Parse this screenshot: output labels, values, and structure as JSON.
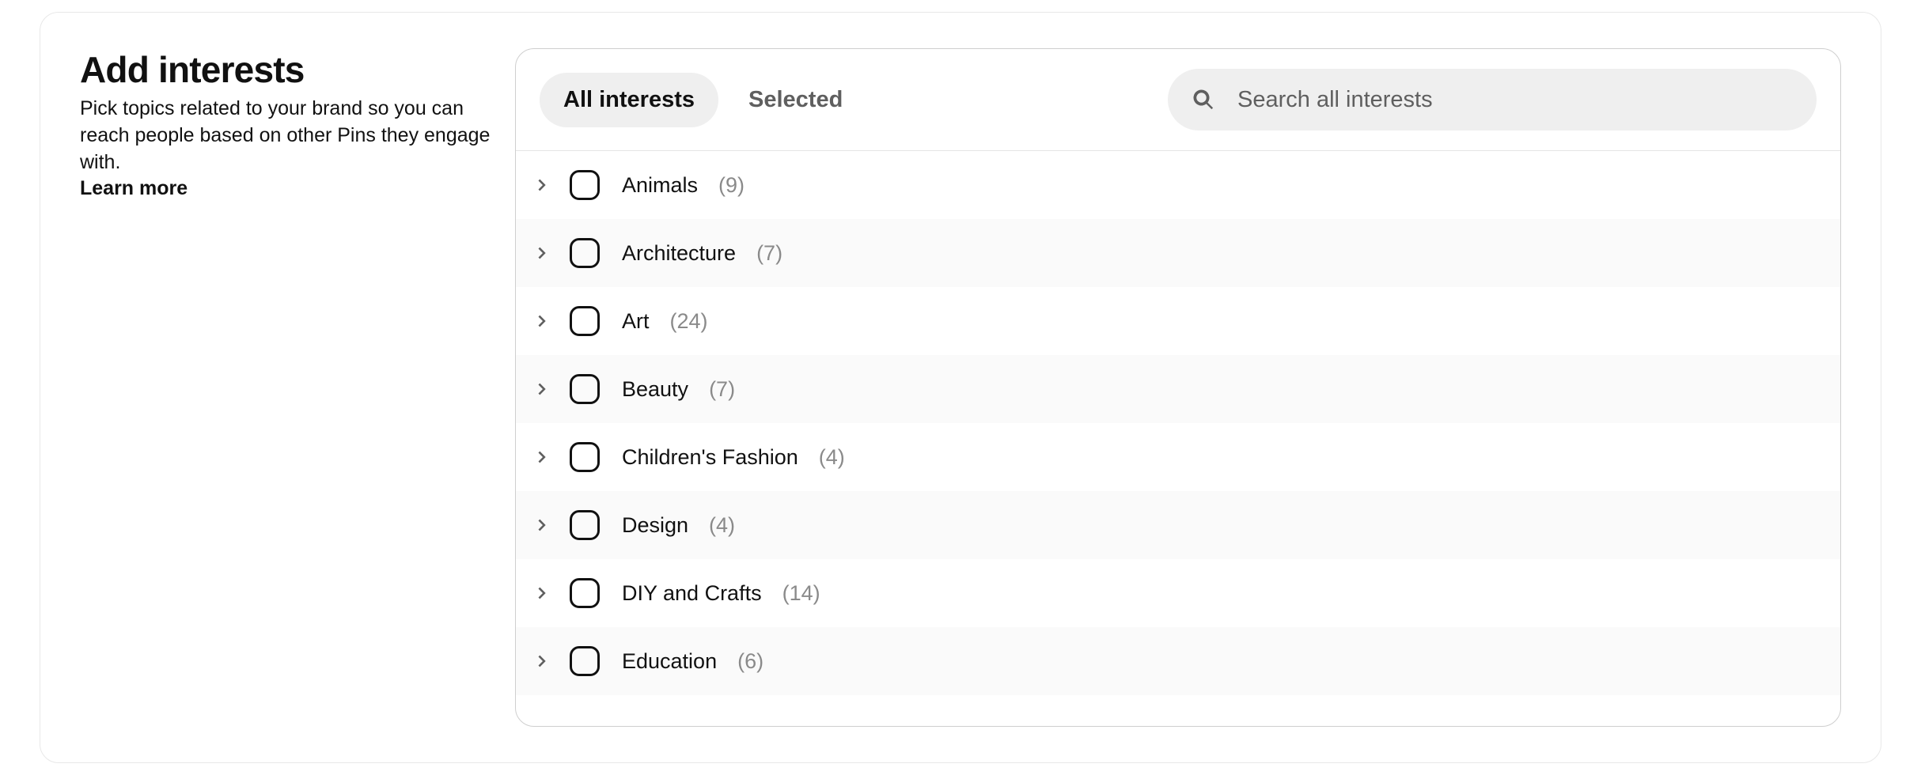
{
  "header": {
    "title": "Add interests",
    "description": "Pick topics related to your brand so you can reach people based on other Pins they engage with.",
    "learn_more_label": "Learn more"
  },
  "tabs": {
    "all_label": "All interests",
    "selected_label": "Selected"
  },
  "search": {
    "placeholder": "Search all interests"
  },
  "interests": [
    {
      "label": "Animals",
      "count": "(9)"
    },
    {
      "label": "Architecture",
      "count": "(7)"
    },
    {
      "label": "Art",
      "count": "(24)"
    },
    {
      "label": "Beauty",
      "count": "(7)"
    },
    {
      "label": "Children's Fashion",
      "count": "(4)"
    },
    {
      "label": "Design",
      "count": "(4)"
    },
    {
      "label": "DIY and Crafts",
      "count": "(14)"
    },
    {
      "label": "Education",
      "count": "(6)"
    }
  ]
}
